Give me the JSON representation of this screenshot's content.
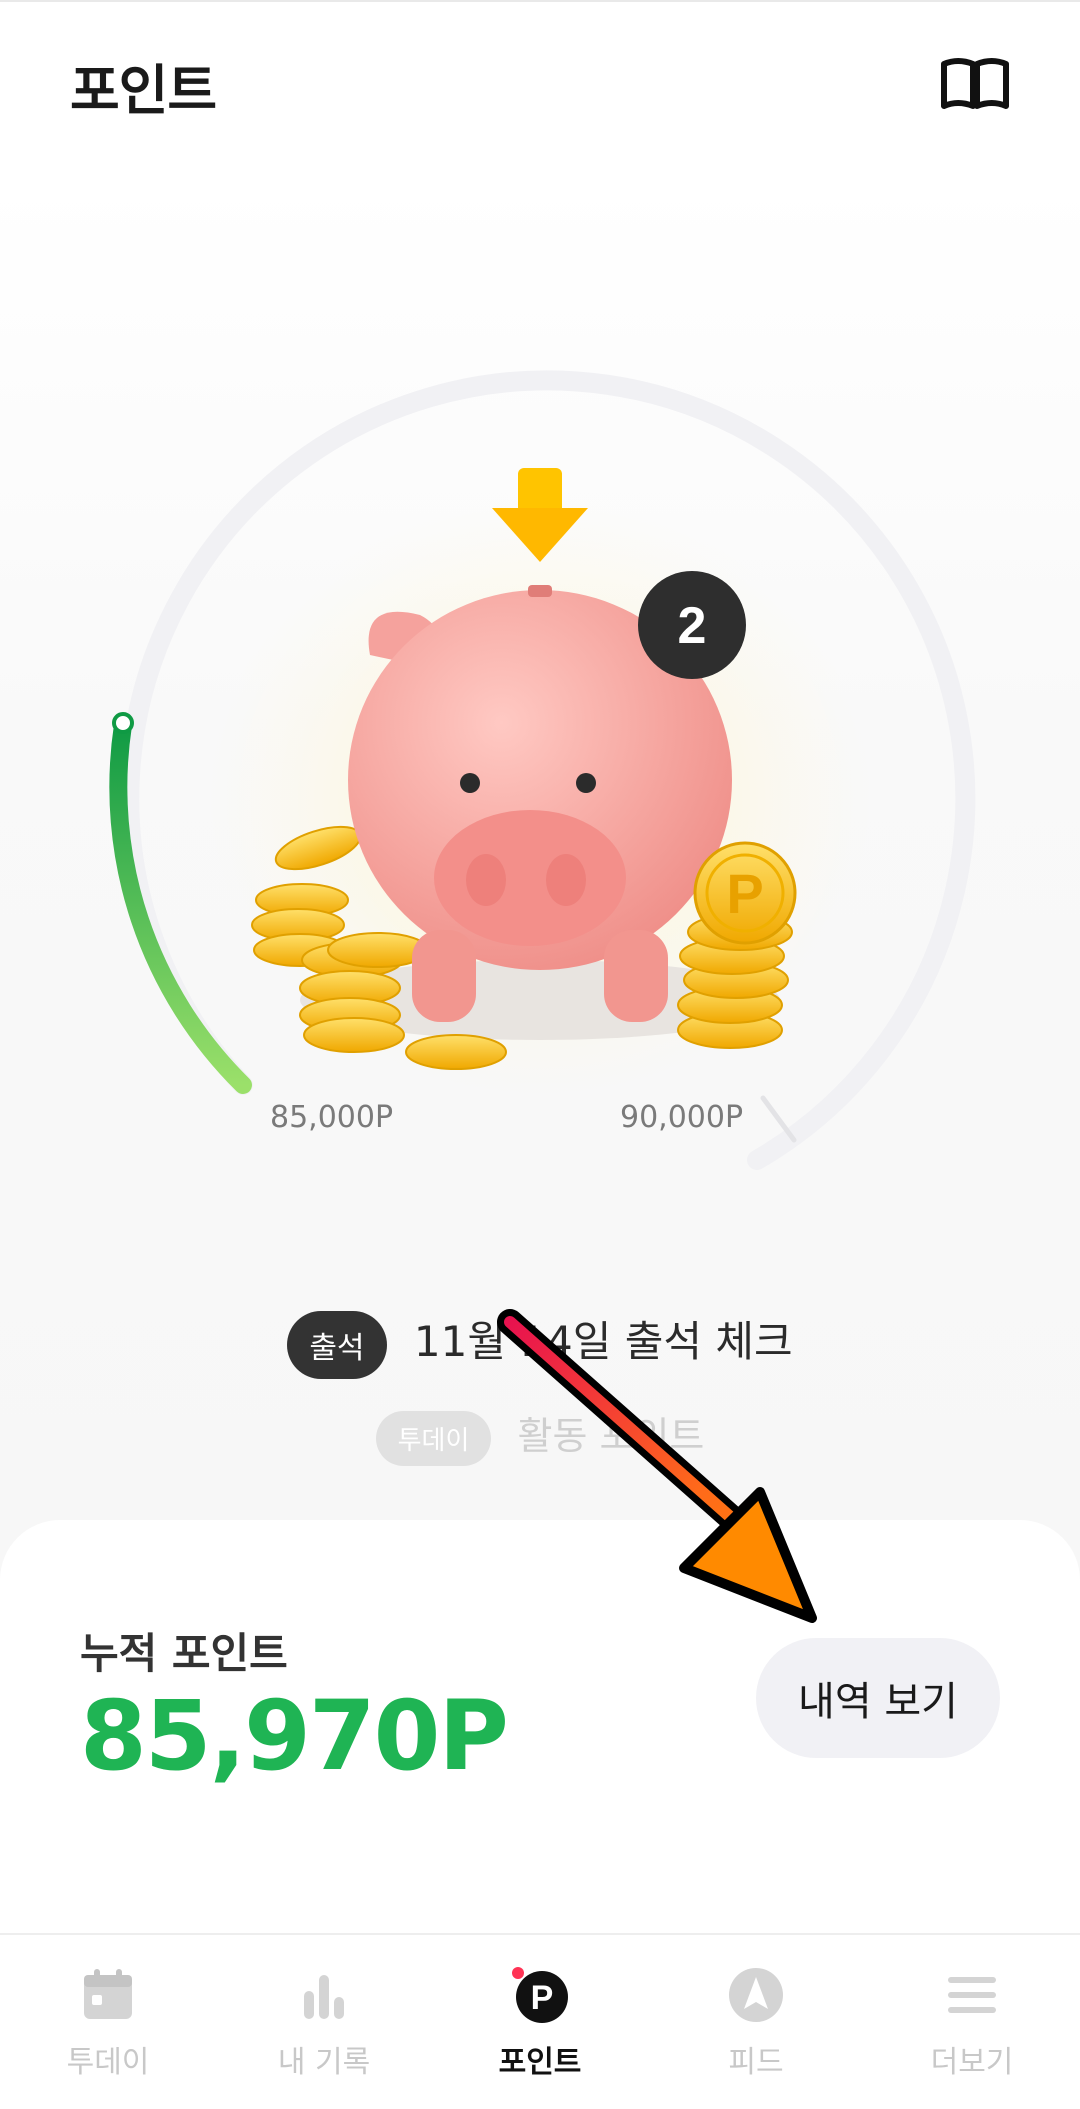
{
  "header": {
    "title": "포인트",
    "guide_icon": "book-open-icon"
  },
  "gauge": {
    "level_badge": "2",
    "start_label": "85,000P",
    "end_label": "90,000P",
    "progress_fraction": 0.19
  },
  "attendance": {
    "badge": "출석",
    "text": "11월 14일 출석 체크"
  },
  "activity": {
    "badge": "투데이",
    "text": "활동 포인트"
  },
  "points_card": {
    "label": "누적 포인트",
    "value": "85,970P",
    "history_button": "내역 보기"
  },
  "bottom_nav": {
    "items": [
      {
        "label": "투데이",
        "icon": "calendar-icon"
      },
      {
        "label": "내 기록",
        "icon": "bar-chart-icon"
      },
      {
        "label": "포인트",
        "icon": "point-p-icon",
        "active": true
      },
      {
        "label": "피드",
        "icon": "compass-icon"
      },
      {
        "label": "더보기",
        "icon": "menu-icon"
      }
    ]
  },
  "colors": {
    "accent_green": "#1fb454",
    "pig_pink": "#f6a7a3",
    "coin_gold": "#f7c325",
    "arrow_orange": "#ff8a00",
    "arrow_red": "#e8124f"
  }
}
